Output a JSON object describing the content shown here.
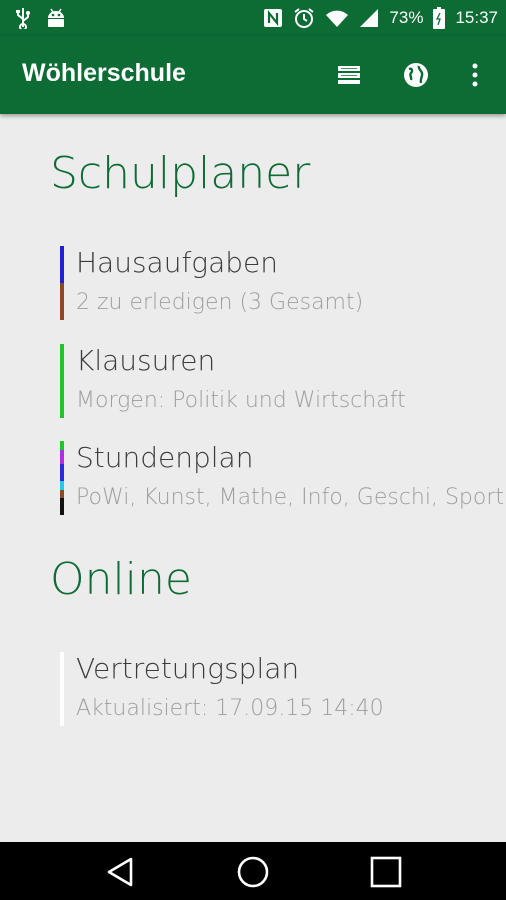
{
  "status_bar": {
    "battery_percent": "73%",
    "time": "15:37",
    "icons": [
      "usb-icon",
      "android-debug-icon",
      "nfc-icon",
      "alarm-icon",
      "wifi-icon",
      "signal-icon",
      "battery-icon"
    ]
  },
  "app_bar": {
    "title": "Wöhlerschule",
    "actions": [
      "list-view-icon",
      "globe-icon",
      "overflow-menu-icon"
    ]
  },
  "sections": {
    "planner": {
      "title": "Schulplaner",
      "items": [
        {
          "title": "Hausaufgaben",
          "subtitle": "2 zu erledigen (3 Gesamt)",
          "colors": [
            "#1f1fd8",
            "#8a4a22"
          ]
        },
        {
          "title": "Klausuren",
          "subtitle": "Morgen: Politik und Wirtschaft",
          "colors": [
            "#22c42d"
          ]
        },
        {
          "title": "Stundenplan",
          "subtitle": "PoWi, Kunst, Mathe, Info, Geschi, Sport",
          "colors": [
            "#22c42d",
            "#b030e0",
            "#2a2ad8",
            "#26c9e6",
            "#8a4a22",
            "#111111"
          ]
        }
      ]
    },
    "online": {
      "title": "Online",
      "items": [
        {
          "title": "Vertretungsplan",
          "subtitle": "Aktualisiert: 17.09.15 14:40",
          "colors": [
            "#ffffff"
          ]
        }
      ]
    }
  },
  "nav_bar": {
    "buttons": [
      "back-icon",
      "home-icon",
      "recents-icon"
    ]
  }
}
